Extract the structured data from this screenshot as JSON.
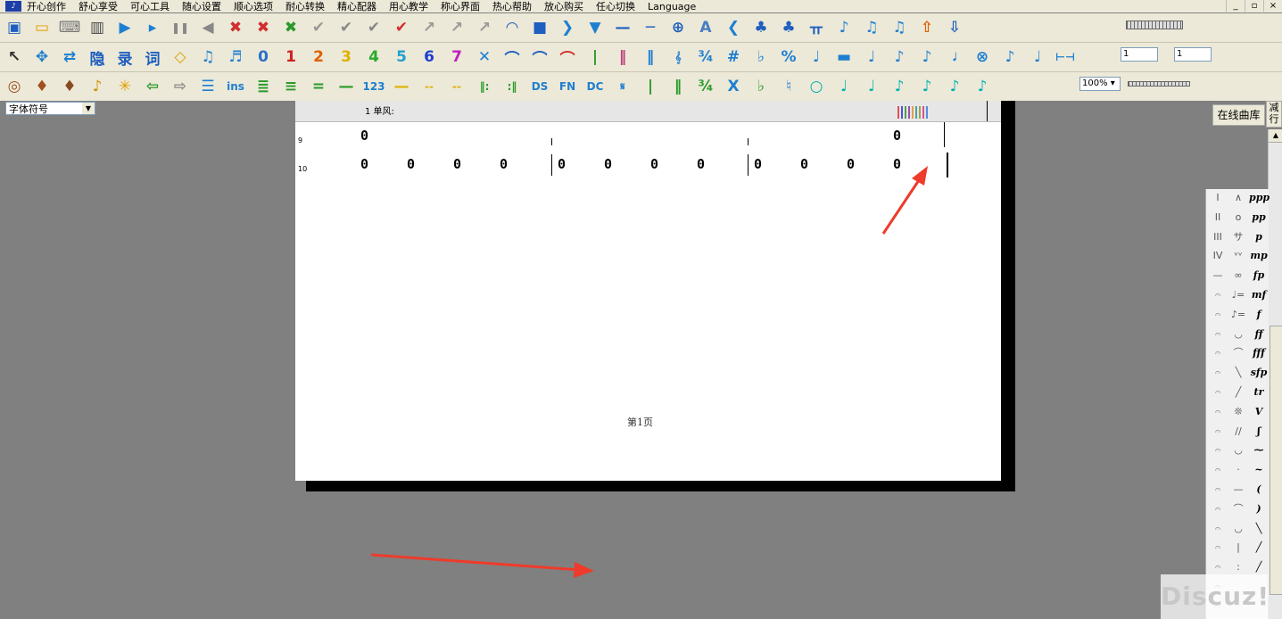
{
  "menu": {
    "items": [
      "开心创作",
      "舒心享受",
      "可心工具",
      "随心设置",
      "顺心选项",
      "耐心转换",
      "精心配器",
      "用心教学",
      "称心界面",
      "热心帮助",
      "放心购买",
      "任心切换",
      "Language"
    ]
  },
  "window_buttons": [
    "_",
    "▫",
    "×"
  ],
  "toolbar": {
    "row1": [
      {
        "icon": "save-icon",
        "glyph": "▣",
        "color": "#1e5fbf"
      },
      {
        "icon": "open-folder-icon",
        "glyph": "▭",
        "color": "#e0a000"
      },
      {
        "icon": "keyboard-icon",
        "glyph": "⌨",
        "color": "#777777"
      },
      {
        "icon": "piano-icon",
        "glyph": "▥",
        "color": "#444444"
      },
      {
        "icon": "play-icon",
        "glyph": "▶",
        "color": "#1e7fd0"
      },
      {
        "icon": "play-from-icon",
        "glyph": "▸",
        "color": "#1e7fd0"
      },
      {
        "icon": "pause-icon",
        "glyph": "❚❚",
        "color": "#888888"
      },
      {
        "icon": "prev-icon",
        "glyph": "◀",
        "color": "#888888"
      },
      {
        "icon": "cross-red-icon",
        "glyph": "✖",
        "color": "#d03030"
      },
      {
        "icon": "cross-blue-icon",
        "glyph": "✖",
        "color": "#d03030"
      },
      {
        "icon": "cross-green-icon",
        "glyph": "✖",
        "color": "#2a9a2a"
      },
      {
        "icon": "check-gray-icon",
        "glyph": "✔",
        "color": "#999999"
      },
      {
        "icon": "color-check-icon",
        "glyph": "✔",
        "color": "#888888"
      },
      {
        "icon": "check-red-icon",
        "glyph": "✔",
        "color": "#888888"
      },
      {
        "icon": "abc-check-icon",
        "glyph": "✔",
        "color": "#d03030"
      },
      {
        "icon": "arrow-check-icon",
        "glyph": "↗",
        "color": "#999999"
      },
      {
        "icon": "arrow-red-icon",
        "glyph": "↗",
        "color": "#999999"
      },
      {
        "icon": "arrow-color-icon",
        "glyph": "↗",
        "color": "#999999"
      },
      {
        "icon": "fermata-icon",
        "glyph": "◠",
        "color": "#1e5fbf"
      },
      {
        "icon": "dot-icon",
        "glyph": "■",
        "color": "#1e5fbf"
      },
      {
        "icon": "chevron-right-icon",
        "glyph": "❯",
        "color": "#1e7fd0"
      },
      {
        "icon": "triangle-down-icon",
        "glyph": "▼",
        "color": "#1e7fd0"
      },
      {
        "icon": "dash-icon",
        "glyph": "—",
        "color": "#1e5fbf"
      },
      {
        "icon": "long-dash-icon",
        "glyph": "─",
        "color": "#1e5fbf"
      },
      {
        "icon": "crosshair-icon",
        "glyph": "⊕",
        "color": "#1e5fbf"
      },
      {
        "icon": "text-a-icon",
        "glyph": "A",
        "color": "#4a7fc0"
      },
      {
        "icon": "chevron-left-icon",
        "glyph": "❮",
        "color": "#1e7fd0"
      },
      {
        "icon": "add-note-icon",
        "glyph": "♣",
        "color": "#1e5fbf"
      },
      {
        "icon": "remove-note-icon",
        "glyph": "♣",
        "color": "#1e5fbf"
      },
      {
        "icon": "tie-icon",
        "glyph": "ㅠ",
        "color": "#1e5fbf"
      },
      {
        "icon": "note-icon",
        "glyph": "♪",
        "color": "#1e7fd0"
      },
      {
        "icon": "note-flag-icon",
        "glyph": "♫",
        "color": "#1e7fd0"
      },
      {
        "icon": "beam-note-icon",
        "glyph": "♫",
        "color": "#1e7fd0"
      },
      {
        "icon": "upload-icon",
        "glyph": "⇧",
        "color": "#e06000"
      },
      {
        "icon": "download-icon",
        "glyph": "⇩",
        "color": "#1e5fbf"
      }
    ],
    "row2": [
      {
        "icon": "pointer-icon",
        "glyph": "↖",
        "color": "#333333"
      },
      {
        "icon": "move-icon",
        "glyph": "✥",
        "color": "#1e7fd0"
      },
      {
        "icon": "transpose-icon",
        "glyph": "⇄",
        "color": "#1e7fd0"
      },
      {
        "icon": "hide-icon",
        "glyph": "隐",
        "color": "#1e5fbf"
      },
      {
        "icon": "record-icon",
        "glyph": "录",
        "color": "#1e5fbf"
      },
      {
        "icon": "lyrics-icon",
        "glyph": "词",
        "color": "#1e5fbf"
      },
      {
        "icon": "eraser-icon",
        "glyph": "◇",
        "color": "#d9a000"
      },
      {
        "icon": "eighth-notes-icon",
        "glyph": "♫",
        "color": "#1e7fd0"
      },
      {
        "icon": "sixteenth-notes-icon",
        "glyph": "♬",
        "color": "#1e7fd0"
      },
      {
        "icon": "digit-0-icon",
        "glyph": "0",
        "color": "#2a6fc9"
      },
      {
        "icon": "digit-1-icon",
        "glyph": "1",
        "color": "#d02020"
      },
      {
        "icon": "digit-2-icon",
        "glyph": "2",
        "color": "#e06000"
      },
      {
        "icon": "digit-3-icon",
        "glyph": "3",
        "color": "#e0b000"
      },
      {
        "icon": "digit-4-icon",
        "glyph": "4",
        "color": "#2aaa2a"
      },
      {
        "icon": "digit-5-icon",
        "glyph": "5",
        "color": "#20a0d0"
      },
      {
        "icon": "digit-6-icon",
        "glyph": "6",
        "color": "#1e40d0"
      },
      {
        "icon": "digit-7-icon",
        "glyph": "7",
        "color": "#c020c0"
      },
      {
        "icon": "x-rest-icon",
        "glyph": "✕",
        "color": "#1e7fd0"
      },
      {
        "icon": "slur-icon",
        "glyph": "⌒",
        "color": "#1e5fbf"
      },
      {
        "icon": "slur-alt-icon",
        "glyph": "⌒",
        "color": "#1e5fbf"
      },
      {
        "icon": "tie-red-icon",
        "glyph": "⌒",
        "color": "#d03030"
      },
      {
        "icon": "barline-icon",
        "glyph": "|",
        "color": "#2a9a2a"
      },
      {
        "icon": "double-bar-icon",
        "glyph": "‖",
        "color": "#c04080"
      },
      {
        "icon": "repeat-icon",
        "glyph": "‖",
        "color": "#1e7fd0"
      },
      {
        "icon": "treble-clef-icon",
        "glyph": "𝄞",
        "color": "#1e7fd0"
      },
      {
        "icon": "time-sig-icon",
        "glyph": "¾",
        "color": "#1e7fd0"
      },
      {
        "icon": "sharp-icon",
        "glyph": "#",
        "color": "#1e7fd0"
      },
      {
        "icon": "flat-icon",
        "glyph": "♭",
        "color": "#1e7fd0"
      },
      {
        "icon": "percent-icon",
        "glyph": "%",
        "color": "#1e7fd0"
      },
      {
        "icon": "quarter-note-icon",
        "glyph": "♩",
        "color": "#1e7fd0"
      },
      {
        "icon": "half-rest-icon",
        "glyph": "▬",
        "color": "#1e7fd0"
      },
      {
        "icon": "note-d-icon",
        "glyph": "♩",
        "color": "#1e7fd0"
      },
      {
        "icon": "note-e-icon",
        "glyph": "♪",
        "color": "#1e7fd0"
      },
      {
        "icon": "note-f-icon",
        "glyph": "♪",
        "color": "#1e7fd0"
      },
      {
        "icon": "cross-note-icon",
        "glyph": "𝅘𝅥",
        "color": "#1e7fd0"
      },
      {
        "icon": "ghost-note-icon",
        "glyph": "⊗",
        "color": "#1e7fd0"
      },
      {
        "icon": "flag-note-icon",
        "glyph": "♪",
        "color": "#1e7fd0"
      },
      {
        "icon": "hook-note-icon",
        "glyph": "♩",
        "color": "#1e7fd0"
      },
      {
        "icon": "stretch-icon",
        "glyph": "⊢⊣",
        "color": "#1e7fd0"
      }
    ],
    "row3": [
      {
        "icon": "drum-icon",
        "glyph": "◎",
        "color": "#a05020"
      },
      {
        "icon": "violin-icon",
        "glyph": "♦",
        "color": "#a05020"
      },
      {
        "icon": "pipa-icon",
        "glyph": "♦",
        "color": "#8a4a20"
      },
      {
        "icon": "sax-icon",
        "glyph": "♪",
        "color": "#d09000"
      },
      {
        "icon": "asterisk-icon",
        "glyph": "✳",
        "color": "#e0a000"
      },
      {
        "icon": "arrow-left-icon",
        "glyph": "⇦",
        "color": "#2a9a2a"
      },
      {
        "icon": "arrow-right-icon",
        "glyph": "⇨",
        "color": "#888888"
      },
      {
        "icon": "lines-icon",
        "glyph": "☰",
        "color": "#1e7fd0"
      },
      {
        "icon": "ins-icon",
        "glyph": "ins",
        "color": "#1e7fd0"
      },
      {
        "icon": "align-4-icon",
        "glyph": "≣",
        "color": "#2a9a2a"
      },
      {
        "icon": "align-3-icon",
        "glyph": "≡",
        "color": "#2a9a2a"
      },
      {
        "icon": "align-2-icon",
        "glyph": "=",
        "color": "#2a9a2a"
      },
      {
        "icon": "align-1-icon",
        "glyph": "—",
        "color": "#2a9a2a"
      },
      {
        "icon": "numbers-123-icon",
        "glyph": "123",
        "color": "#1e7fd0"
      },
      {
        "icon": "yellow-dash-1-icon",
        "glyph": "—",
        "color": "#e0b000"
      },
      {
        "icon": "yellow-dash-2-icon",
        "glyph": "--",
        "color": "#e0b000"
      },
      {
        "icon": "yellow-dash-3-icon",
        "glyph": "--",
        "color": "#e0b000"
      },
      {
        "icon": "repeat-start-icon",
        "glyph": "‖:",
        "color": "#2a9a2a"
      },
      {
        "icon": "repeat-end-icon",
        "glyph": ":‖",
        "color": "#2a9a2a"
      },
      {
        "icon": "ds-icon",
        "glyph": "DS",
        "color": "#1e7fd0"
      },
      {
        "icon": "fn-icon",
        "glyph": "FN",
        "color": "#1e7fd0"
      },
      {
        "icon": "dc-icon",
        "glyph": "DC",
        "color": "#1e7fd0"
      },
      {
        "icon": "segno-icon",
        "glyph": "𝄋",
        "color": "#1e7fd0"
      },
      {
        "icon": "bar-green-icon",
        "glyph": "|",
        "color": "#2a9a2a"
      },
      {
        "icon": "bar-green-2-icon",
        "glyph": "‖",
        "color": "#2a9a2a"
      },
      {
        "icon": "fraction-icon",
        "glyph": "¾",
        "color": "#2a9a2a"
      },
      {
        "icon": "x-icon",
        "glyph": "X",
        "color": "#1e7fd0"
      },
      {
        "icon": "bb-icon",
        "glyph": "♭",
        "color": "#2a9a2a"
      },
      {
        "icon": "natural-icon",
        "glyph": "♮",
        "color": "#1e7fd0"
      },
      {
        "icon": "whole-note-icon",
        "glyph": "○",
        "color": "#00b0b0"
      },
      {
        "icon": "half-note-icon",
        "glyph": "♩",
        "color": "#00b0b0"
      },
      {
        "icon": "quarter-teal-icon",
        "glyph": "♩",
        "color": "#00b0b0"
      },
      {
        "icon": "eighth-teal-icon",
        "glyph": "♪",
        "color": "#00b0b0"
      },
      {
        "icon": "sixteenth-teal-icon",
        "glyph": "♪",
        "color": "#00b0b0"
      },
      {
        "icon": "thirtysecond-teal-icon",
        "glyph": "♪",
        "color": "#00b0b0"
      },
      {
        "icon": "sixtyfourth-teal-icon",
        "glyph": "♪",
        "color": "#00b0b0"
      }
    ],
    "spin1": "1",
    "spin2": "1",
    "zoom": "100%"
  },
  "font_selector": "字体符号",
  "online_library": "在线曲库",
  "reduce_rows": "减行",
  "score": {
    "ruler_label": "1 单风:",
    "row_numbers": [
      "9",
      "10"
    ],
    "row10_notes": [
      "0",
      "0",
      "0",
      "0",
      "0",
      "0",
      "0",
      "0",
      "0",
      "0",
      "0",
      "0"
    ],
    "page_label": "第1页"
  },
  "palette": {
    "col1": [
      "I",
      "II",
      "III",
      "IV",
      "—",
      "𝄐",
      "𝄐",
      "𝄐",
      "𝄐",
      "𝄐",
      "𝄐",
      "𝄐",
      "𝄐",
      "𝄐",
      "𝄐",
      "𝄐",
      "𝄐",
      "𝄐",
      "𝄐",
      "𝄐",
      "𝄐",
      "𝄐"
    ],
    "col2": [
      "∧",
      "o",
      "サ",
      "ᵛᵛ",
      "∞",
      "♩=",
      "♪=",
      "◡",
      "⌒",
      "╲",
      "╱",
      "❊",
      "∕∕",
      "◡",
      "·",
      "—",
      "⌒",
      "◡",
      "|",
      ":"
    ],
    "col3": [
      "ppp",
      "pp",
      "p",
      "mp",
      "fp",
      "mf",
      "f",
      "ff",
      "fff",
      "sfp",
      "tr",
      "V",
      "ʃ",
      "⁓",
      "~",
      "(",
      ")",
      "╲",
      "╱",
      "╱"
    ]
  },
  "watermark": "Discuz!"
}
